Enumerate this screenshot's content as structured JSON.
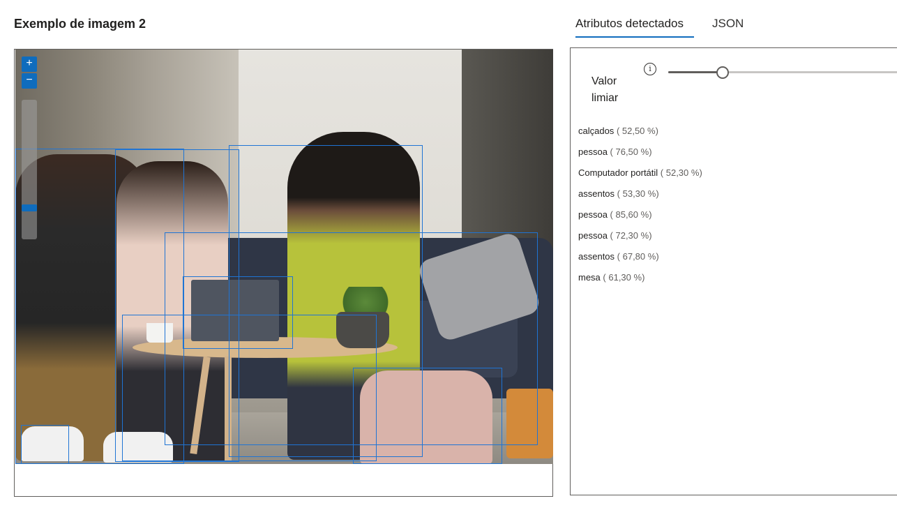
{
  "header": {
    "title": "Exemplo de imagem 2"
  },
  "zoom": {
    "in_label": "+",
    "out_label": "−",
    "level": 0.2
  },
  "tabs": [
    {
      "label": "Atributos detectados",
      "active": true
    },
    {
      "label": "JSON",
      "active": false
    }
  ],
  "threshold": {
    "label": "Valor limiar",
    "info_icon": "info-icon",
    "value": 0.23
  },
  "attributes": [
    {
      "name": "calçados",
      "confidence": "( 52,50 %)"
    },
    {
      "name": "pessoa",
      "confidence": "( 76,50 %)"
    },
    {
      "name": "Computador portátil",
      "confidence": "( 52,30 %)"
    },
    {
      "name": "assentos",
      "confidence": "( 53,30 %)"
    },
    {
      "name": "pessoa",
      "confidence": "( 85,60 %)"
    },
    {
      "name": "pessoa",
      "confidence": "( 72,30 %)"
    },
    {
      "name": "assentos",
      "confidence": "( 67,80 %)"
    },
    {
      "name": "mesa",
      "confidence": "( 61,30 %)"
    }
  ],
  "colors": {
    "accent": "#0f6cbd",
    "bbox": "#1f74d4"
  }
}
